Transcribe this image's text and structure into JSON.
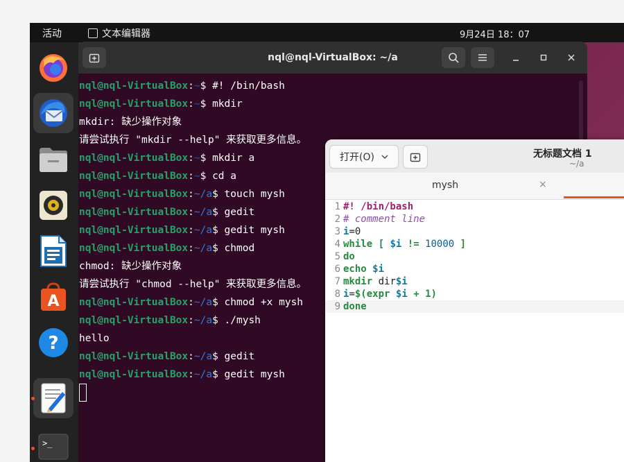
{
  "topbar": {
    "activities": "活动",
    "app_name": "文本编辑器",
    "clock": "9月24日 18：07"
  },
  "dock": {
    "items": [
      {
        "name": "firefox"
      },
      {
        "name": "thunderbird"
      },
      {
        "name": "files"
      },
      {
        "name": "rhythmbox"
      },
      {
        "name": "libreoffice-writer"
      },
      {
        "name": "app-center"
      },
      {
        "name": "help"
      },
      {
        "name": "text-editor"
      },
      {
        "name": "terminal"
      }
    ],
    "terminal_icon_text": ">_",
    "app_center_letter": "A",
    "help_text": "?"
  },
  "terminal": {
    "title": "nql@nql-VirtualBox: ~/a",
    "lines": [
      {
        "user": "nql@nql-VirtualBox",
        "colon": ":",
        "path": "~",
        "cmd": "$ #! /bin/bash"
      },
      {
        "user": "nql@nql-VirtualBox",
        "colon": ":",
        "path": "~",
        "cmd": "$ mkdir"
      },
      {
        "text": "mkdir: 缺少操作对象"
      },
      {
        "text": "请尝试执行 \"mkdir --help\" 来获取更多信息。"
      },
      {
        "user": "nql@nql-VirtualBox",
        "colon": ":",
        "path": "~",
        "cmd": "$ mkdir a"
      },
      {
        "user": "nql@nql-VirtualBox",
        "colon": ":",
        "path": "~",
        "cmd": "$ cd a"
      },
      {
        "user": "nql@nql-VirtualBox",
        "colon": ":",
        "path": "~/a",
        "cmd": "$ touch mysh"
      },
      {
        "user": "nql@nql-VirtualBox",
        "colon": ":",
        "path": "~/a",
        "cmd": "$ gedit"
      },
      {
        "user": "nql@nql-VirtualBox",
        "colon": ":",
        "path": "~/a",
        "cmd": "$ gedit mysh"
      },
      {
        "user": "nql@nql-VirtualBox",
        "colon": ":",
        "path": "~/a",
        "cmd": "$ chmod"
      },
      {
        "text": "chmod: 缺少操作对象"
      },
      {
        "text": "请尝试执行 \"chmod --help\" 来获取更多信息。"
      },
      {
        "user": "nql@nql-VirtualBox",
        "colon": ":",
        "path": "~/a",
        "cmd": "$ chmod +x mysh"
      },
      {
        "user": "nql@nql-VirtualBox",
        "colon": ":",
        "path": "~/a",
        "cmd": "$ ./mysh"
      },
      {
        "text": "hello"
      },
      {
        "user": "nql@nql-VirtualBox",
        "colon": ":",
        "path": "~/a",
        "cmd": "$ gedit"
      },
      {
        "user": "nql@nql-VirtualBox",
        "colon": ":",
        "path": "~/a",
        "cmd": "$ gedit mysh"
      }
    ]
  },
  "gedit": {
    "open_label": "打开(O)",
    "title": "无标题文档 1",
    "subtitle": "~/a",
    "tab_label": "mysh",
    "tab_close": "×",
    "code": [
      {
        "n": "1",
        "parts": [
          {
            "c": "sh",
            "t": "#! /bin/bash"
          }
        ]
      },
      {
        "n": "2",
        "parts": [
          {
            "c": "cm",
            "t": "# comment line"
          }
        ]
      },
      {
        "n": "3",
        "parts": [
          {
            "c": "va",
            "t": "i"
          },
          {
            "c": "tx",
            "t": "=0"
          }
        ]
      },
      {
        "n": "4",
        "parts": [
          {
            "c": "kw",
            "t": "while"
          },
          {
            "c": "tx",
            "t": " "
          },
          {
            "c": "kw",
            "t": "["
          },
          {
            "c": "tx",
            "t": " "
          },
          {
            "c": "va",
            "t": "$i"
          },
          {
            "c": "tx",
            "t": " "
          },
          {
            "c": "kw",
            "t": "!="
          },
          {
            "c": "tx",
            "t": " "
          },
          {
            "c": "nu",
            "t": "10000"
          },
          {
            "c": "tx",
            "t": " "
          },
          {
            "c": "kw",
            "t": "]"
          }
        ]
      },
      {
        "n": "5",
        "parts": [
          {
            "c": "kw",
            "t": "do"
          }
        ]
      },
      {
        "n": "6",
        "parts": [
          {
            "c": "kw",
            "t": "echo"
          },
          {
            "c": "tx",
            "t": " "
          },
          {
            "c": "va",
            "t": "$i"
          }
        ]
      },
      {
        "n": "7",
        "parts": [
          {
            "c": "kw",
            "t": "mkdir"
          },
          {
            "c": "tx",
            "t": " dir"
          },
          {
            "c": "va",
            "t": "$i"
          }
        ]
      },
      {
        "n": "8",
        "parts": [
          {
            "c": "va",
            "t": "i"
          },
          {
            "c": "tx",
            "t": "="
          },
          {
            "c": "kw",
            "t": "$(expr"
          },
          {
            "c": "tx",
            "t": " "
          },
          {
            "c": "va",
            "t": "$i"
          },
          {
            "c": "tx",
            "t": " "
          },
          {
            "c": "kw",
            "t": "+"
          },
          {
            "c": "tx",
            "t": " "
          },
          {
            "c": "kw",
            "t": "1)"
          }
        ]
      },
      {
        "n": "9",
        "parts": [
          {
            "c": "kw",
            "t": "done"
          }
        ]
      }
    ]
  }
}
